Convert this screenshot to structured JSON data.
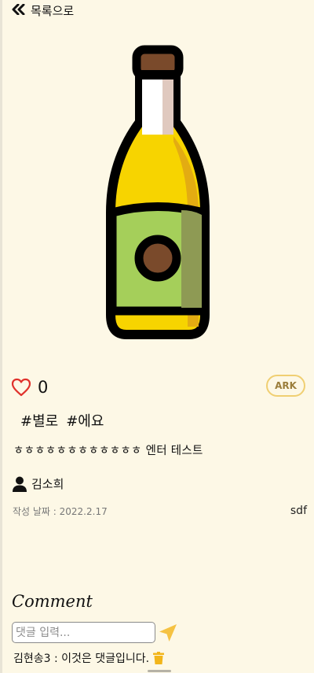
{
  "nav": {
    "back_label": "목록으로",
    "back_icon": "double-chevron-left-icon"
  },
  "post": {
    "image_alt": "beer-bottle-illustration",
    "likes": "0",
    "badge_label": "ARK",
    "tags": [
      "#별로",
      "#에요"
    ],
    "body": "ㅎㅎㅎㅎㅎㅎㅎㅎㅎㅎㅎㅎ 엔터 테스트",
    "author": "김소희",
    "date_text": "작성 날짜 : 2022.2.17",
    "side_note": "sdf"
  },
  "comments": {
    "title": "Comment",
    "input_placeholder": "댓글 입력...",
    "items": [
      {
        "text": "김현송3 : 이것은 댓글입니다."
      }
    ]
  },
  "colors": {
    "background": "#fdf8e6",
    "heart": "#e0312b",
    "badge_border": "#f0cf72",
    "send_icon": "#f5c242",
    "trash_icon": "#f2b51a"
  }
}
